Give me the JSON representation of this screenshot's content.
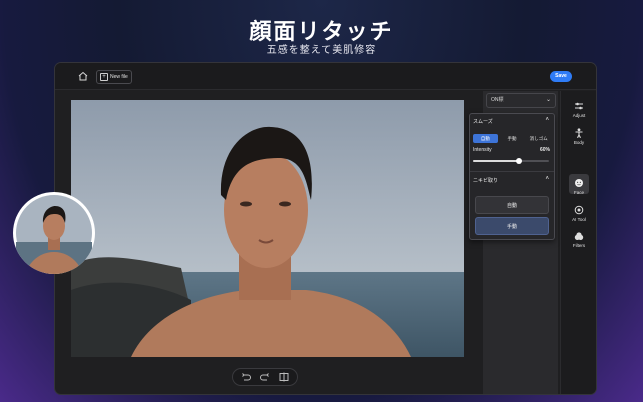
{
  "promo": {
    "title": "顔面リタッチ",
    "subtitle": "五感を整えて美肌修容"
  },
  "topbar": {
    "new_file_label": "New file",
    "save_label": "Save"
  },
  "panel": {
    "preset_value": "ON標",
    "smooth": {
      "title": "スムーズ",
      "tabs": [
        "自動",
        "手動",
        "消しゴム"
      ],
      "active_tab": "自動",
      "intensity_label": "Intensity",
      "intensity_value": "60%",
      "intensity_fraction": 0.6
    },
    "acne": {
      "title": "ニキビ取り",
      "auto_label": "自動",
      "manual_label": "手動"
    }
  },
  "rightbar": {
    "items": [
      {
        "label": "Adjust",
        "icon": "sliders-icon"
      },
      {
        "label": "Body",
        "icon": "body-icon"
      },
      {
        "label": "Face",
        "icon": "face-icon"
      },
      {
        "label": "AI Tool",
        "icon": "ai-tool-icon"
      },
      {
        "label": "Filters",
        "icon": "filters-icon"
      }
    ]
  },
  "colors": {
    "accent": "#2f7cf6",
    "active_segment": "#3d74d8",
    "window_bg": "#1f1f21"
  }
}
